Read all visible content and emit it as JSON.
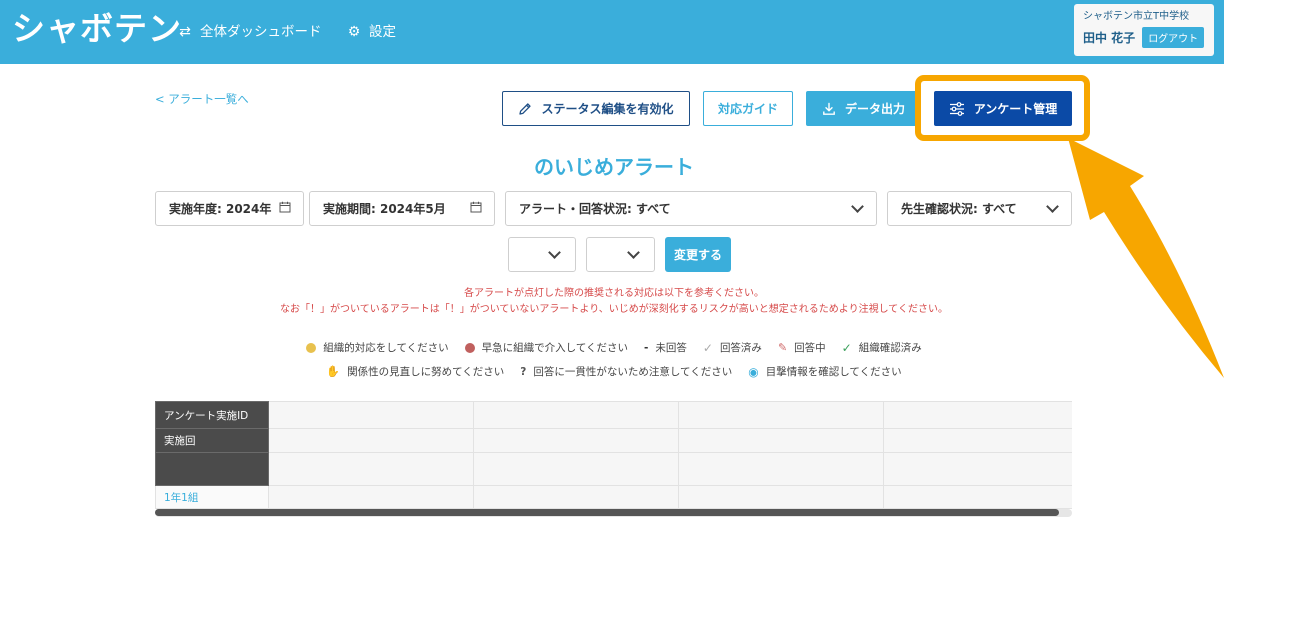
{
  "header": {
    "logo": "シャボテン",
    "nav": {
      "dashboard": "全体ダッシュボード",
      "settings": "設定"
    },
    "user": {
      "school": "シャボテン市立T中学校",
      "name": "田中 花子",
      "logout": "ログアウト"
    }
  },
  "back_link": "< アラート一覧へ",
  "toolbar": {
    "status_edit": "ステータス編集を有効化",
    "guide": "対応ガイド",
    "export": "データ出力",
    "survey_manage": "アンケート管理"
  },
  "title": "のいじめアラート",
  "filters": {
    "year": "実施年度: 2024年",
    "period": "実施期間: 2024年5月",
    "alert_status": "アラート・回答状況: すべて",
    "teacher_status": "先生確認状況: すべて",
    "change_button": "変更する"
  },
  "notices": {
    "line1": "各アラートが点灯した際の推奨される対応は以下を参考ください。",
    "line2": "なお「！」がついているアラートは「！」がついていないアラートより、いじめが深刻化するリスクが高いと想定されるためより注視してください。"
  },
  "legend": {
    "row1": {
      "organized": "組織的対応をしてください",
      "early": "早急に組織で介入してください",
      "unanswered_mark": "-",
      "unanswered": "未回答",
      "answered": "回答済み",
      "in_progress": "回答中",
      "org_confirmed": "組織確認済み"
    },
    "row2": {
      "relationship": "関係性の見直しに努めてください",
      "consistency_mark": "?",
      "consistency": "回答に一貫性がないため注意してください",
      "witness": "目撃情報を確認してください"
    }
  },
  "table": {
    "row_headers": [
      "アンケート実施ID",
      "実施回",
      "",
      "1年1組"
    ]
  },
  "colors": {
    "header_bg": "#3aaedb",
    "primary_dark": "#0b4aa6",
    "highlight": "#f7a600",
    "notice_red": "#d64a4a"
  },
  "icons": {
    "dashboard": "swap-arrows-icon",
    "settings": "gear-icon",
    "status_edit": "pencil-icon",
    "export": "download-icon",
    "survey_manage": "sliders-icon",
    "calendar": "calendar-icon"
  }
}
